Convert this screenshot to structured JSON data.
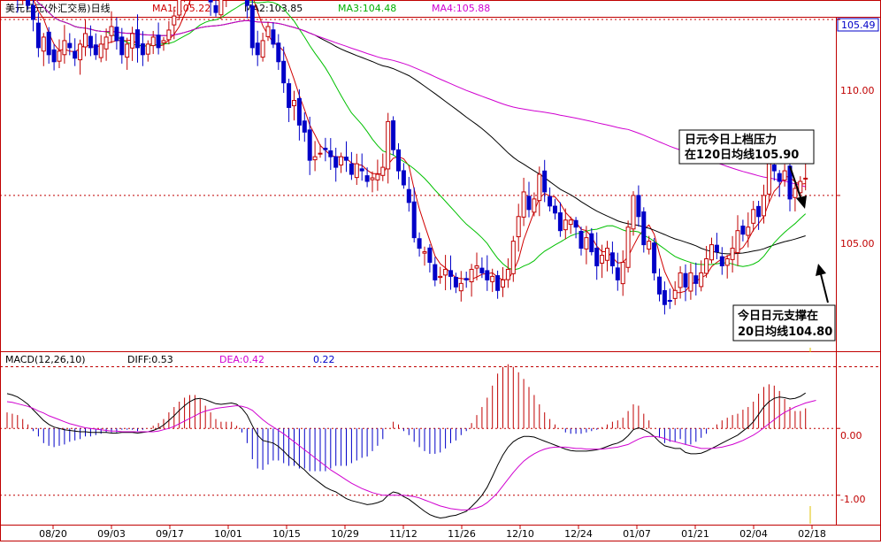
{
  "header": {
    "title": "美元日元(外汇交易)日线",
    "ma1": "MA1:105.22",
    "ma2": "MA2:103.85",
    "ma3": "MA3:104.48",
    "ma4": "MA4:105.88"
  },
  "macd_header": {
    "name": "MACD(12,26,10)",
    "diff": "DIFF:0.53",
    "dea": "DEA:0.42",
    "macd": "0.22"
  },
  "annotations": {
    "resistance_line1": "日元今日上档压力",
    "resistance_line2": "在120日均线105.90",
    "support_line1": "今日日元支撑在",
    "support_line2": "20日均线104.80"
  },
  "colors": {
    "up": "#c00000",
    "down": "#0000c8",
    "ma1": "#d00000",
    "ma2": "#000000",
    "ma3": "#00c000",
    "ma4": "#d000d0",
    "grid": "#c00000"
  },
  "chart_data": [
    {
      "type": "candlestick",
      "y_ticks": [
        "110.00",
        "105.00"
      ],
      "last_price_label": "105.49",
      "ylim": [
        101.0,
        109.8
      ],
      "x_labels": [
        "08/20",
        "09/03",
        "09/17",
        "10/01",
        "10/15",
        "10/29",
        "11/12",
        "11/26",
        "12/10",
        "12/24",
        "01/07",
        "01/21",
        "02/04",
        "02/18"
      ],
      "close": [
        111.2,
        110.9,
        110.6,
        111.0,
        110.4,
        110.0,
        109.2,
        109.5,
        109.0,
        108.8,
        109.1,
        109.4,
        109.2,
        108.9,
        109.3,
        109.6,
        109.2,
        109.0,
        109.3,
        109.5,
        109.8,
        109.4,
        109.0,
        109.3,
        109.6,
        109.2,
        109.0,
        109.3,
        109.5,
        109.2,
        109.4,
        109.7,
        110.1,
        110.6,
        110.9,
        111.2,
        111.6,
        111.3,
        110.8,
        110.5,
        110.2,
        110.6,
        111.0,
        111.3,
        111.4,
        111.1,
        110.4,
        109.2,
        109.0,
        109.4,
        109.8,
        109.3,
        108.8,
        108.2,
        107.5,
        107.7,
        107.0,
        106.8,
        106.0,
        106.1,
        106.2,
        106.3,
        106.1,
        105.8,
        106.1,
        106.0,
        105.6,
        105.9,
        105.7,
        105.4,
        105.5,
        105.6,
        105.8,
        107.1,
        106.3,
        105.7,
        105.3,
        104.8,
        103.8,
        103.5,
        103.4,
        103.1,
        102.6,
        102.7,
        102.9,
        102.7,
        102.4,
        102.5,
        102.6,
        102.9,
        103.0,
        102.8,
        102.6,
        102.7,
        102.3,
        102.6,
        102.9,
        103.7,
        104.4,
        105.1,
        104.6,
        104.9,
        105.6,
        105.1,
        104.7,
        104.5,
        104.0,
        104.3,
        104.3,
        104.1,
        103.5,
        103.8,
        103.4,
        103.0,
        103.3,
        103.5,
        103.0,
        102.6,
        103.1,
        104.1,
        105.0,
        104.4,
        103.6,
        103.7,
        102.8,
        102.2,
        101.9,
        102.0,
        102.3,
        102.8,
        102.4,
        102.8,
        102.5,
        102.8,
        103.2,
        103.6,
        103.4,
        103.0,
        103.2,
        103.5,
        104.0,
        103.9,
        104.1,
        104.6,
        104.4,
        105.0,
        105.9,
        105.7,
        105.4,
        105.7,
        104.9,
        105.2,
        105.4,
        105.49
      ]
    },
    {
      "type": "bar",
      "name": "MACD(12,26,10)",
      "y_ticks": [
        "0.00",
        "-1.00"
      ],
      "ylim": [
        -1.4,
        0.85
      ],
      "diff": [
        0.52,
        0.5,
        0.47,
        0.42,
        0.36,
        0.28,
        0.2,
        0.12,
        0.06,
        0.02,
        0.0,
        -0.02,
        -0.03,
        -0.04,
        -0.05,
        -0.05,
        -0.06,
        -0.06,
        -0.06,
        -0.06,
        -0.07,
        -0.07,
        -0.06,
        -0.06,
        -0.06,
        -0.07,
        -0.06,
        -0.05,
        -0.03,
        0.0,
        0.05,
        0.12,
        0.19,
        0.27,
        0.34,
        0.4,
        0.44,
        0.45,
        0.43,
        0.4,
        0.37,
        0.36,
        0.37,
        0.38,
        0.36,
        0.3,
        0.2,
        0.04,
        -0.1,
        -0.18,
        -0.2,
        -0.22,
        -0.27,
        -0.34,
        -0.42,
        -0.48,
        -0.56,
        -0.62,
        -0.7,
        -0.76,
        -0.82,
        -0.88,
        -0.92,
        -0.95,
        -1.0,
        -1.05,
        -1.08,
        -1.1,
        -1.12,
        -1.14,
        -1.13,
        -1.11,
        -1.08,
        -1.0,
        -0.95,
        -0.97,
        -1.02,
        -1.06,
        -1.12,
        -1.18,
        -1.24,
        -1.29,
        -1.32,
        -1.34,
        -1.33,
        -1.31,
        -1.3,
        -1.27,
        -1.24,
        -1.17,
        -1.09,
        -1.0,
        -0.88,
        -0.72,
        -0.55,
        -0.4,
        -0.28,
        -0.2,
        -0.15,
        -0.12,
        -0.12,
        -0.13,
        -0.16,
        -0.19,
        -0.22,
        -0.25,
        -0.28,
        -0.31,
        -0.33,
        -0.34,
        -0.34,
        -0.34,
        -0.33,
        -0.32,
        -0.3,
        -0.27,
        -0.24,
        -0.22,
        -0.18,
        -0.11,
        -0.02,
        0.01,
        -0.02,
        -0.06,
        -0.12,
        -0.2,
        -0.26,
        -0.28,
        -0.3,
        -0.3,
        -0.36,
        -0.38,
        -0.38,
        -0.37,
        -0.34,
        -0.3,
        -0.26,
        -0.22,
        -0.18,
        -0.14,
        -0.1,
        -0.04,
        0.02,
        0.1,
        0.21,
        0.32,
        0.4,
        0.45,
        0.47,
        0.46,
        0.44,
        0.45,
        0.48,
        0.53
      ],
      "dea": [
        0.4,
        0.39,
        0.37,
        0.35,
        0.33,
        0.3,
        0.26,
        0.23,
        0.19,
        0.16,
        0.13,
        0.1,
        0.07,
        0.05,
        0.03,
        0.01,
        0.0,
        -0.01,
        -0.02,
        -0.03,
        -0.04,
        -0.04,
        -0.05,
        -0.05,
        -0.05,
        -0.05,
        -0.05,
        -0.05,
        -0.05,
        -0.04,
        -0.02,
        0.0,
        0.03,
        0.07,
        0.11,
        0.15,
        0.19,
        0.23,
        0.26,
        0.28,
        0.3,
        0.31,
        0.32,
        0.33,
        0.34,
        0.33,
        0.31,
        0.27,
        0.2,
        0.13,
        0.07,
        0.02,
        -0.03,
        -0.08,
        -0.14,
        -0.2,
        -0.26,
        -0.32,
        -0.38,
        -0.44,
        -0.5,
        -0.56,
        -0.62,
        -0.67,
        -0.72,
        -0.77,
        -0.82,
        -0.86,
        -0.9,
        -0.93,
        -0.96,
        -0.98,
        -1.0,
        -1.0,
        -1.0,
        -1.0,
        -1.0,
        -1.01,
        -1.02,
        -1.04,
        -1.07,
        -1.1,
        -1.13,
        -1.16,
        -1.18,
        -1.2,
        -1.21,
        -1.22,
        -1.22,
        -1.21,
        -1.19,
        -1.16,
        -1.11,
        -1.04,
        -0.96,
        -0.86,
        -0.76,
        -0.66,
        -0.57,
        -0.49,
        -0.43,
        -0.38,
        -0.34,
        -0.31,
        -0.29,
        -0.28,
        -0.28,
        -0.28,
        -0.29,
        -0.3,
        -0.3,
        -0.31,
        -0.31,
        -0.31,
        -0.31,
        -0.3,
        -0.29,
        -0.28,
        -0.26,
        -0.24,
        -0.2,
        -0.16,
        -0.13,
        -0.12,
        -0.12,
        -0.13,
        -0.15,
        -0.18,
        -0.2,
        -0.22,
        -0.24,
        -0.26,
        -0.28,
        -0.3,
        -0.3,
        -0.3,
        -0.29,
        -0.28,
        -0.26,
        -0.24,
        -0.21,
        -0.18,
        -0.14,
        -0.1,
        -0.05,
        0.01,
        0.07,
        0.13,
        0.19,
        0.24,
        0.28,
        0.32,
        0.35,
        0.38,
        0.4,
        0.42
      ]
    }
  ]
}
